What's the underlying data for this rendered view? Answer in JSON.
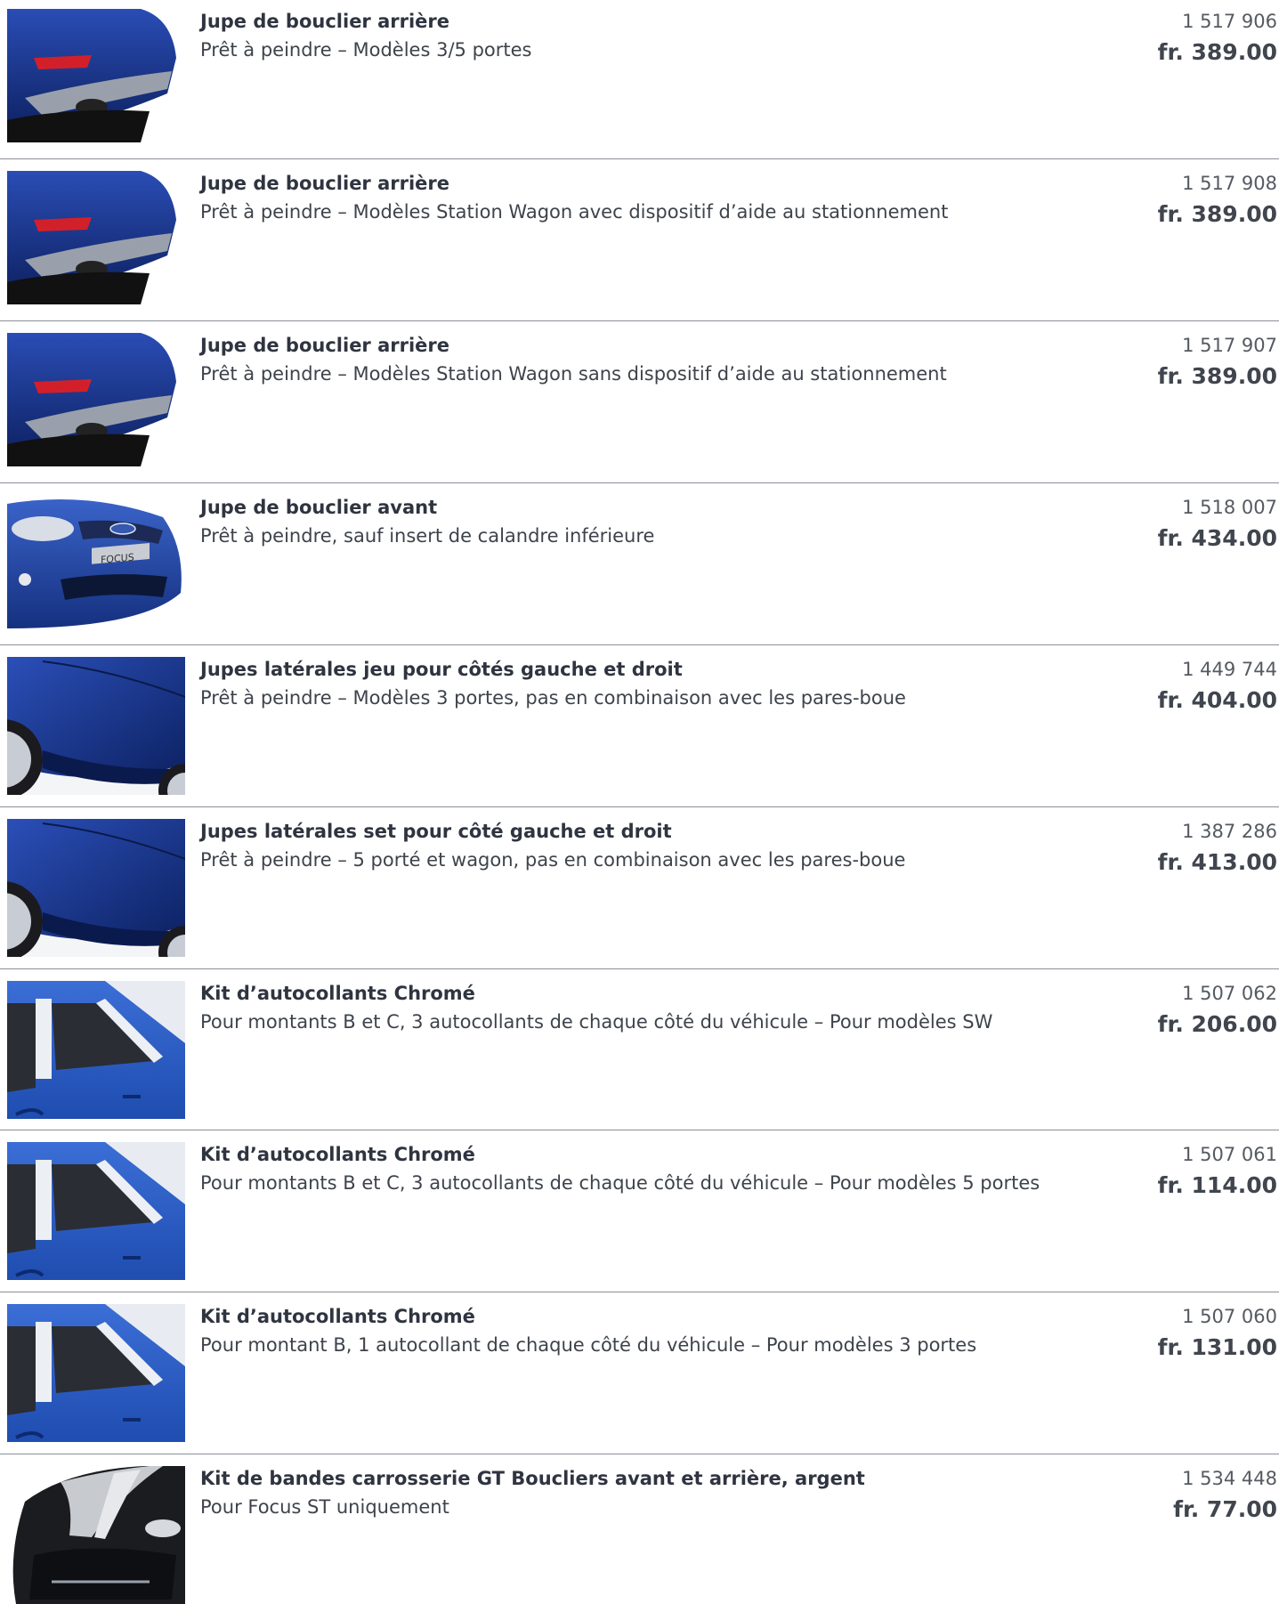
{
  "items": [
    {
      "title": "Jupe de bouclier arrière",
      "desc": "Prêt à peindre – Modèles 3/5 portes",
      "ref": "1 517 906",
      "price": "fr. 389.00",
      "image": "rear-bumper-image"
    },
    {
      "title": "Jupe de bouclier arrière",
      "desc": "Prêt à peindre – Modèles Station Wagon avec dispositif d’aide au stationnement",
      "ref": "1 517 908",
      "price": "fr. 389.00",
      "image": "rear-bumper-image"
    },
    {
      "title": "Jupe de bouclier arrière",
      "desc": "Prêt à peindre – Modèles Station Wagon sans dispositif d’aide au stationnement",
      "ref": "1 517 907",
      "price": "fr. 389.00",
      "image": "rear-bumper-image"
    },
    {
      "title": "Jupe de bouclier avant",
      "desc": "Prêt à peindre, sauf insert de calandre inférieure",
      "ref": "1 518 007",
      "price": "fr. 434.00",
      "image": "front-bumper-image"
    },
    {
      "title": "Jupes latérales jeu pour côtés gauche et droit",
      "desc": "Prêt à peindre – Modèles 3 portes, pas en combinaison avec les pares-boue",
      "ref": "1 449 744",
      "price": "fr. 404.00",
      "image": "side-skirt-image"
    },
    {
      "title": "Jupes latérales set pour côté gauche et droit",
      "desc": "Prêt à peindre – 5 porté et wagon, pas en combinaison avec les pares-boue",
      "ref": "1 387 286",
      "price": "fr. 413.00",
      "image": "side-skirt-image"
    },
    {
      "title": "Kit d’autocollants Chromé",
      "desc": "Pour montants B et C, 3 autocollants de chaque côté du véhicule – Pour modèles SW",
      "ref": "1 507 062",
      "price": "fr. 206.00",
      "image": "chrome-pillar-image"
    },
    {
      "title": "Kit d’autocollants Chromé",
      "desc": "Pour montants B et C, 3 autocollants de chaque côté du véhicule – Pour modèles 5 portes",
      "ref": "1 507 061",
      "price": "fr. 114.00",
      "image": "chrome-pillar-image"
    },
    {
      "title": "Kit d’autocollants Chromé",
      "desc": "Pour montant B, 1 autocollant de chaque côté du véhicule – Pour modèles 3 portes",
      "ref": "1 507 060",
      "price": "fr. 131.00",
      "image": "chrome-pillar-image"
    },
    {
      "title": "Kit de bandes carrosserie GT Boucliers avant et arrière, argent",
      "desc": "Pour Focus ST uniquement",
      "ref": "1 534 448",
      "price": "fr. 77.00",
      "image": "gt-stripe-image"
    }
  ],
  "logo_text": "FOCUS",
  "colors": {
    "car_blue": "#1f3f9a",
    "text": "#33373f",
    "separator": "#8a8f96"
  }
}
